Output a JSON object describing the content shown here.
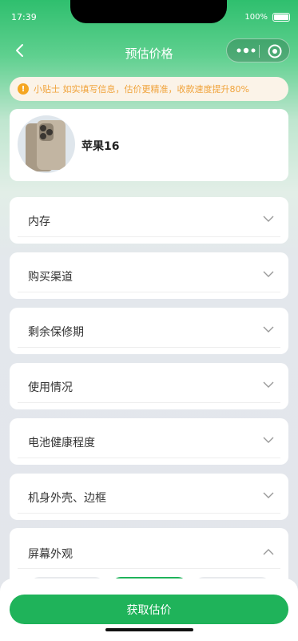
{
  "status": {
    "time": "17:39",
    "battery_pct": "100%"
  },
  "nav": {
    "title": "预估价格"
  },
  "tip": {
    "text": "小贴士 如实填写信息，估价更精准，收款速度提升80%"
  },
  "product": {
    "name": "苹果16"
  },
  "options": [
    {
      "label": "内存"
    },
    {
      "label": "购买渠道"
    },
    {
      "label": "剩余保修期"
    },
    {
      "label": "使用情况"
    },
    {
      "label": "电池健康程度"
    },
    {
      "label": "机身外壳、边框"
    }
  ],
  "expanded": {
    "label": "屏幕外观"
  },
  "cta": {
    "label": "获取估价"
  },
  "colors": {
    "primary": "#1fb35a",
    "tip_text": "#f0a33b",
    "tip_bg": "#fbf3e8"
  }
}
